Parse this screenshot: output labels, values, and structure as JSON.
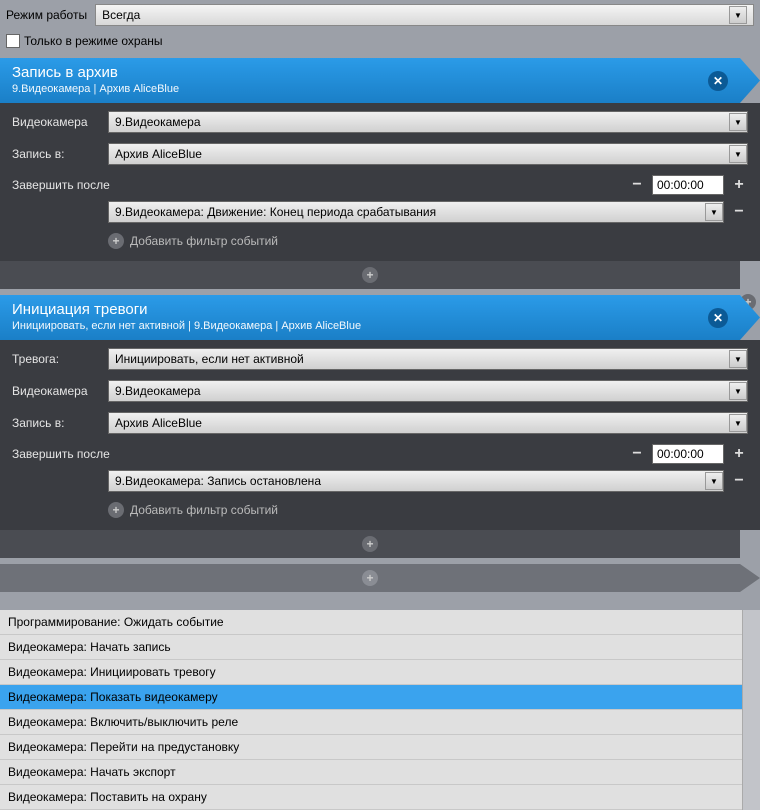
{
  "top": {
    "mode_label": "Режим работы",
    "mode_value": "Всегда",
    "guard_only": "Только в режиме охраны"
  },
  "block1": {
    "title": "Запись в архив",
    "subtitle": "9.Видеокамера | Архив AliceBlue",
    "camera_label": "Видеокамера",
    "camera_value": "9.Видеокамера",
    "record_label": "Запись в:",
    "record_value": "Архив AliceBlue",
    "finish_label": "Завершить после",
    "time_value": "00:00:00",
    "filter_value": "9.Видеокамера: Движение: Конец периода срабатывания",
    "add_filter": "Добавить фильтр событий"
  },
  "block2": {
    "title": "Инициация тревоги",
    "subtitle": "Инициировать, если нет активной | 9.Видеокамера | Архив AliceBlue",
    "alarm_label": "Тревога:",
    "alarm_value": "Инициировать, если нет активной",
    "camera_label": "Видеокамера",
    "camera_value": "9.Видеокамера",
    "record_label": "Запись в:",
    "record_value": "Архив AliceBlue",
    "finish_label": "Завершить после",
    "time_value": "00:00:00",
    "filter_value": "9.Видеокамера: Запись остановлена",
    "add_filter": "Добавить фильтр событий"
  },
  "actions": [
    "Программирование: Ожидать событие",
    "Видеокамера: Начать запись",
    "Видеокамера: Инициировать тревогу",
    "Видеокамера: Показать видеокамеру",
    "Видеокамера: Включить/выключить реле",
    "Видеокамера: Перейти на предустановку",
    "Видеокамера: Начать экспорт",
    "Видеокамера: Поставить на охрану"
  ],
  "selected_action_index": 3
}
